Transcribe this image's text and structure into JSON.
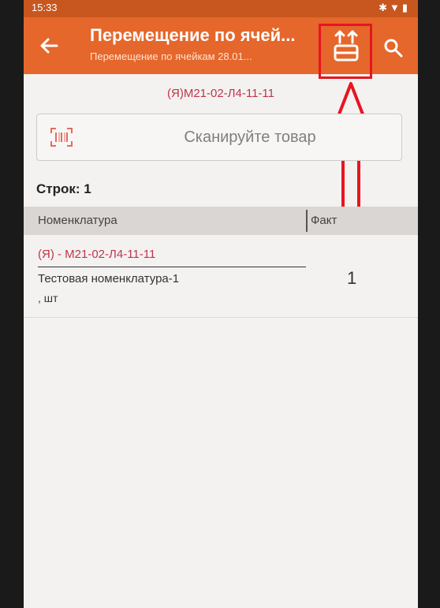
{
  "status_bar": {
    "time": "15:33",
    "icons": "✱▼▮"
  },
  "toolbar": {
    "title": "Перемещение по ячей...",
    "subtitle": "Перемещение по ячейкам 28.01..."
  },
  "cell_name": "(Я)М21-02-Л4-11-11",
  "scan": {
    "placeholder": "Сканируйте товар"
  },
  "rows": {
    "label": "Строк: 1"
  },
  "table": {
    "headers": [
      "Номенклатура",
      "Факт"
    ],
    "rows": [
      {
        "cell": "(Я) - М21-02-Л4-11-11",
        "name": "Тестовая номенклатура-1",
        "unit": ", шт",
        "fact": "1"
      }
    ]
  },
  "colors": {
    "toolbar": "#e5672c",
    "accent_text": "#c0344a",
    "highlight": "#e8151f"
  }
}
